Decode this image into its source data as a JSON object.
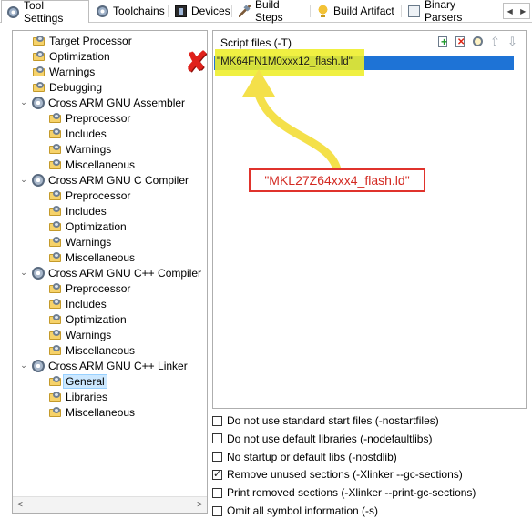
{
  "tabs": [
    {
      "label": "Tool Settings",
      "icon": "gear-icon",
      "active": true
    },
    {
      "label": "Toolchains",
      "icon": "gear-icon"
    },
    {
      "label": "Devices",
      "icon": "chip-icon"
    },
    {
      "label": "Build Steps",
      "icon": "hammer-icon"
    },
    {
      "label": "Build Artifact",
      "icon": "trophy-icon"
    },
    {
      "label": "Binary Parsers",
      "icon": "binary-icon"
    }
  ],
  "tree": [
    {
      "label": "Target Processor",
      "level": 1,
      "type": "folder"
    },
    {
      "label": "Optimization",
      "level": 1,
      "type": "folder"
    },
    {
      "label": "Warnings",
      "level": 1,
      "type": "folder"
    },
    {
      "label": "Debugging",
      "level": 1,
      "type": "folder"
    },
    {
      "label": "Cross ARM GNU Assembler",
      "level": 0,
      "type": "gear",
      "expanded": true
    },
    {
      "label": "Preprocessor",
      "level": 2,
      "type": "folder"
    },
    {
      "label": "Includes",
      "level": 2,
      "type": "folder"
    },
    {
      "label": "Warnings",
      "level": 2,
      "type": "folder"
    },
    {
      "label": "Miscellaneous",
      "level": 2,
      "type": "folder"
    },
    {
      "label": "Cross ARM GNU C Compiler",
      "level": 0,
      "type": "gear",
      "expanded": true
    },
    {
      "label": "Preprocessor",
      "level": 2,
      "type": "folder"
    },
    {
      "label": "Includes",
      "level": 2,
      "type": "folder"
    },
    {
      "label": "Optimization",
      "level": 2,
      "type": "folder"
    },
    {
      "label": "Warnings",
      "level": 2,
      "type": "folder"
    },
    {
      "label": "Miscellaneous",
      "level": 2,
      "type": "folder"
    },
    {
      "label": "Cross ARM GNU C++ Compiler",
      "level": 0,
      "type": "gear",
      "expanded": true
    },
    {
      "label": "Preprocessor",
      "level": 2,
      "type": "folder"
    },
    {
      "label": "Includes",
      "level": 2,
      "type": "folder"
    },
    {
      "label": "Optimization",
      "level": 2,
      "type": "folder"
    },
    {
      "label": "Warnings",
      "level": 2,
      "type": "folder"
    },
    {
      "label": "Miscellaneous",
      "level": 2,
      "type": "folder"
    },
    {
      "label": "Cross ARM GNU C++ Linker",
      "level": 0,
      "type": "gear",
      "expanded": true
    },
    {
      "label": "General",
      "level": 2,
      "type": "folder",
      "selected": true
    },
    {
      "label": "Libraries",
      "level": 2,
      "type": "folder"
    },
    {
      "label": "Miscellaneous",
      "level": 2,
      "type": "folder"
    }
  ],
  "script_files": {
    "title": "Script files (-T)",
    "items": [
      "\"MK64FN1M0xxx12_flash.ld\""
    ]
  },
  "annotation": {
    "callout": "\"MKL27Z64xxx4_flash.ld\"",
    "highlight_color": "#eeee28",
    "callout_color": "#e0332c",
    "arrow_color": "#f4e04a"
  },
  "options": [
    {
      "label": "Do not use standard start files (-nostartfiles)",
      "checked": false
    },
    {
      "label": "Do not use default libraries (-nodefaultlibs)",
      "checked": false
    },
    {
      "label": "No startup or default libs (-nostdlib)",
      "checked": false
    },
    {
      "label": "Remove unused sections (-Xlinker --gc-sections)",
      "checked": true
    },
    {
      "label": "Print removed sections (-Xlinker --print-gc-sections)",
      "checked": false
    },
    {
      "label": "Omit all symbol information (-s)",
      "checked": false
    }
  ]
}
